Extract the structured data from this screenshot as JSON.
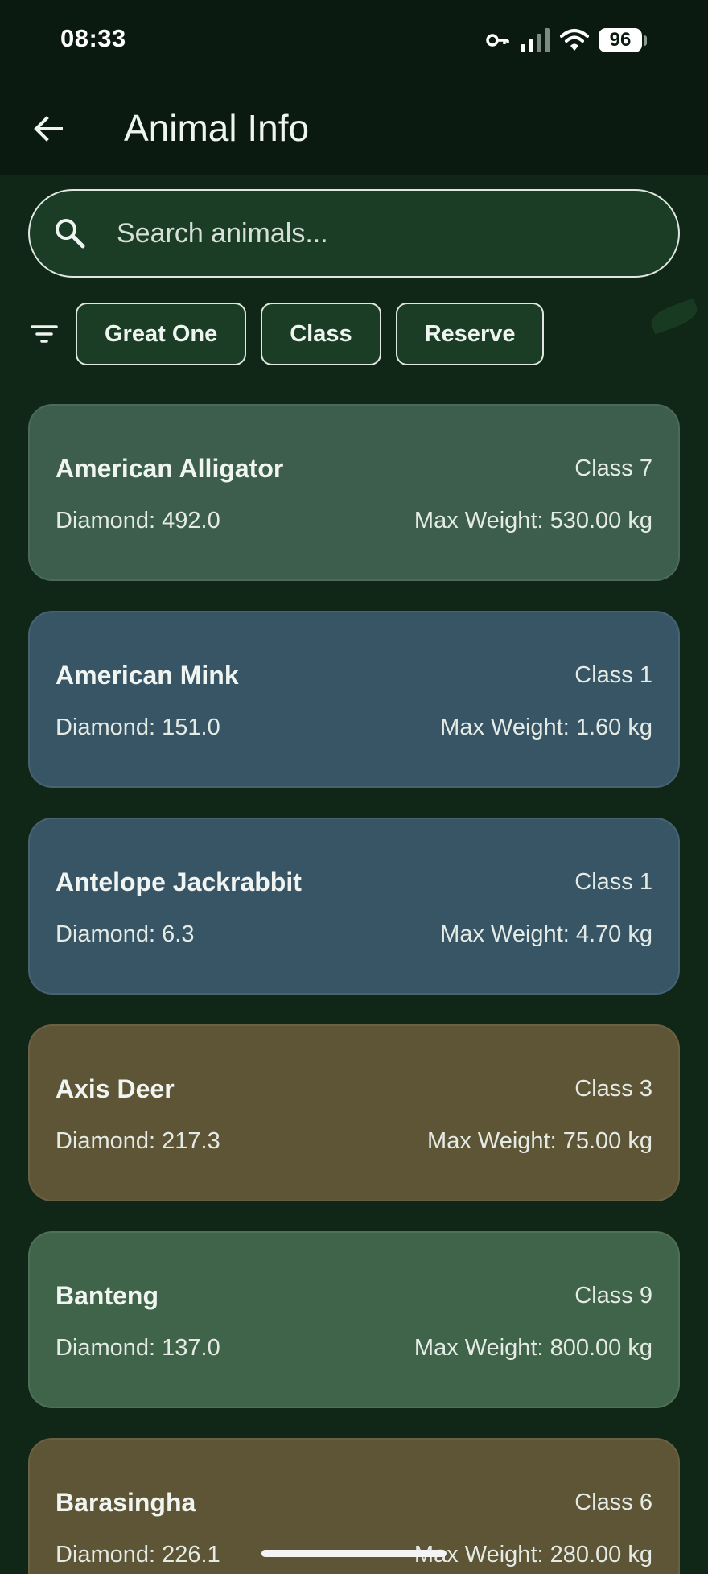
{
  "status_bar": {
    "time": "08:33",
    "battery": "96",
    "icons": [
      "key-icon",
      "signal-icon",
      "wifi-icon",
      "battery-icon"
    ]
  },
  "app_bar": {
    "title": "Animal Info",
    "back_icon": "arrow-left-icon"
  },
  "search": {
    "placeholder": "Search animals...",
    "value": ""
  },
  "filters": {
    "icon": "filter-icon",
    "chips": [
      "Great One",
      "Class",
      "Reserve"
    ]
  },
  "colors": {
    "background": "#102617",
    "card_green": "#3d5e4c",
    "card_blue": "#385566",
    "card_brown": "#5e5436",
    "card_moss": "#40644a"
  },
  "animals": [
    {
      "name": "American Alligator",
      "class": "Class 7",
      "diamond": "Diamond: 492.0",
      "max_weight": "Max Weight: 530.00 kg",
      "color": "#3d5e4c"
    },
    {
      "name": "American Mink",
      "class": "Class 1",
      "diamond": "Diamond: 151.0",
      "max_weight": "Max Weight: 1.60 kg",
      "color": "#385566"
    },
    {
      "name": "Antelope Jackrabbit",
      "class": "Class 1",
      "diamond": "Diamond: 6.3",
      "max_weight": "Max Weight: 4.70 kg",
      "color": "#385566"
    },
    {
      "name": "Axis Deer",
      "class": "Class 3",
      "diamond": "Diamond: 217.3",
      "max_weight": "Max Weight: 75.00 kg",
      "color": "#5e5436"
    },
    {
      "name": "Banteng",
      "class": "Class 9",
      "diamond": "Diamond: 137.0",
      "max_weight": "Max Weight: 800.00 kg",
      "color": "#40644a"
    },
    {
      "name": "Barasingha",
      "class": "Class 6",
      "diamond": "Diamond: 226.1",
      "max_weight": "Max Weight: 280.00 kg",
      "color": "#5e5436"
    }
  ]
}
